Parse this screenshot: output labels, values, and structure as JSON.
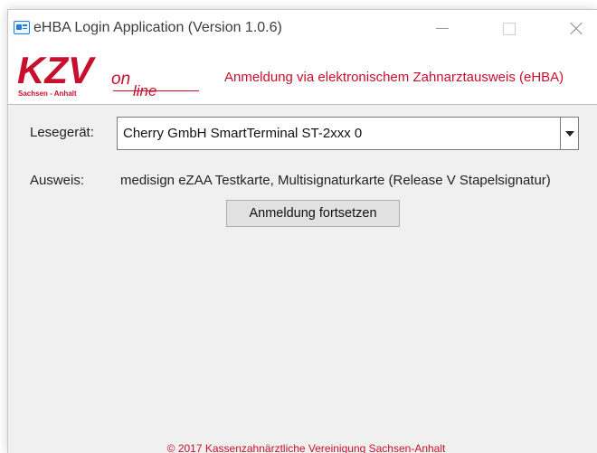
{
  "window": {
    "title": "eHBA Login Application (Version 1.0.6)",
    "icon": "login-app-icon"
  },
  "colors": {
    "brand_red": "#c8102e",
    "accent_blue": "#1e7fd6"
  },
  "banner": {
    "logo_text": "KZV",
    "logo_subtitle": "Sachsen - Anhalt",
    "logo_on": "on",
    "logo_line": "line",
    "headline": "Anmeldung via elektronischem Zahnarztausweis (eHBA)"
  },
  "form": {
    "reader_label": "Lesegerät:",
    "reader_value": "Cherry GmbH SmartTerminal ST-2xxx 0",
    "card_label": "Ausweis:",
    "card_value": "medisign eZAA Testkarte, Multisignaturkarte (Release V Stapelsignatur)",
    "continue_button": "Anmeldung fortsetzen"
  },
  "footer": {
    "text": "© 2017 Kassenzahnärztliche Vereinigung Sachsen-Anhalt"
  }
}
